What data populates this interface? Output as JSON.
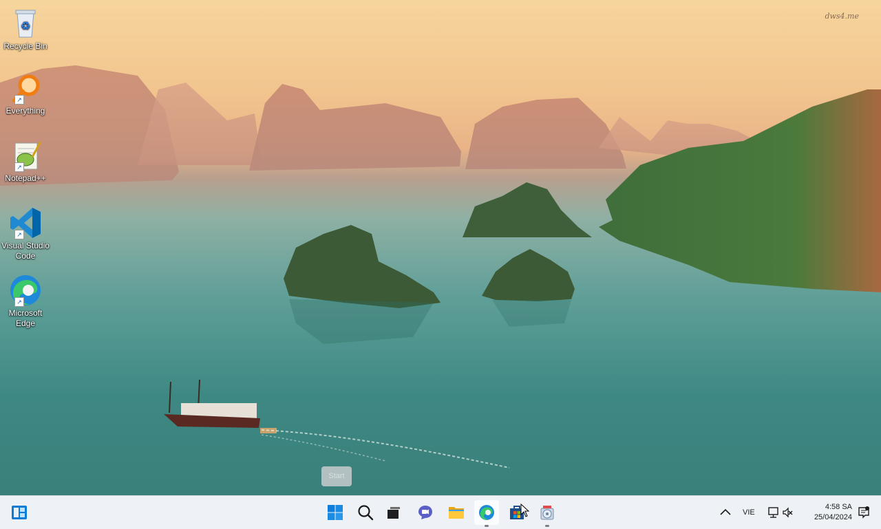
{
  "desktop": {
    "watermark": "dws4.me",
    "icons": [
      {
        "label": "Recycle Bin",
        "icon": "recycle-bin-icon"
      },
      {
        "label": "Everything",
        "icon": "everything-search-icon"
      },
      {
        "label": "Notepad++",
        "icon": "notepad-plus-plus-icon"
      },
      {
        "label": "Visual Studio Code",
        "icon": "vscode-icon"
      },
      {
        "label": "Microsoft Edge",
        "icon": "edge-icon"
      }
    ]
  },
  "tooltip": {
    "text": "Start"
  },
  "taskbar": {
    "widgets_icon": "widgets-icon",
    "pinned": [
      {
        "name": "start-button",
        "icon": "windows-logo-icon"
      },
      {
        "name": "search-button",
        "icon": "search-icon"
      },
      {
        "name": "task-view-button",
        "icon": "task-view-icon"
      },
      {
        "name": "chat-button",
        "icon": "chat-icon"
      },
      {
        "name": "file-explorer-button",
        "icon": "folder-icon"
      },
      {
        "name": "edge-button",
        "icon": "edge-icon"
      },
      {
        "name": "store-button",
        "icon": "store-icon"
      },
      {
        "name": "installer-button",
        "icon": "installer-icon"
      }
    ],
    "tray": {
      "overflow_icon": "chevron-up-icon",
      "language": "VIE",
      "network_icon": "network-icon",
      "volume_icon": "volume-muted-icon",
      "time": "4:58 SA",
      "date": "25/04/2024",
      "notification_icon": "notification-icon"
    }
  },
  "colors": {
    "taskbar_bg": "#eef2f6",
    "windows_blue": "#0078d4",
    "sky": "#f6d59c",
    "water": "#3e8883"
  }
}
